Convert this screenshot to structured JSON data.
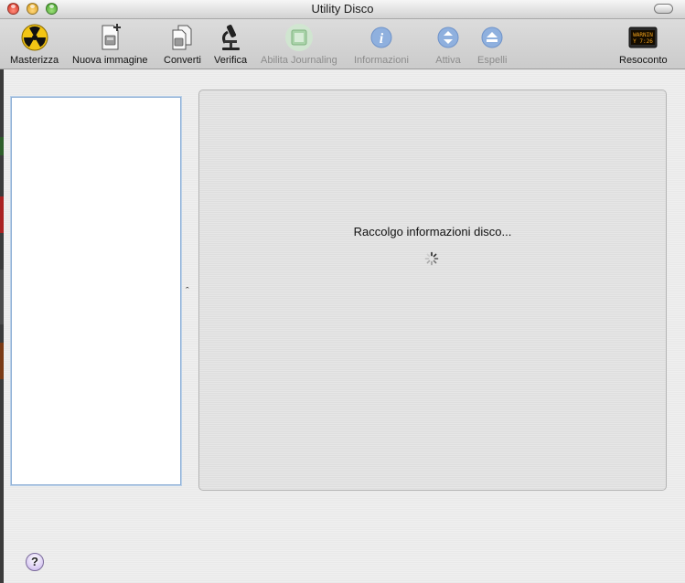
{
  "window": {
    "title": "Utility Disco"
  },
  "toolbar": {
    "items": [
      {
        "label": "Masterizza",
        "icon": "burn-icon",
        "enabled": true
      },
      {
        "label": "Nuova immagine",
        "icon": "new-image-icon",
        "enabled": true
      },
      {
        "label": "Converti",
        "icon": "convert-icon",
        "enabled": true
      },
      {
        "label": "Verifica",
        "icon": "microscope-icon",
        "enabled": true
      },
      {
        "label": "Abilita Journaling",
        "icon": "journaling-icon",
        "enabled": false
      },
      {
        "label": "Informazioni",
        "icon": "info-icon",
        "enabled": false
      },
      {
        "label": "Attiva",
        "icon": "mount-icon",
        "enabled": false
      },
      {
        "label": "Espelli",
        "icon": "eject-icon",
        "enabled": false
      },
      {
        "label": "Resoconto",
        "icon": "log-icon",
        "enabled": true
      }
    ]
  },
  "main": {
    "status_text": "Raccolgo informazioni disco..."
  },
  "help": {
    "label": "?"
  },
  "colors": {
    "disabled_text": "#8c8c8c",
    "sidebar_border": "#8fb0d6"
  }
}
